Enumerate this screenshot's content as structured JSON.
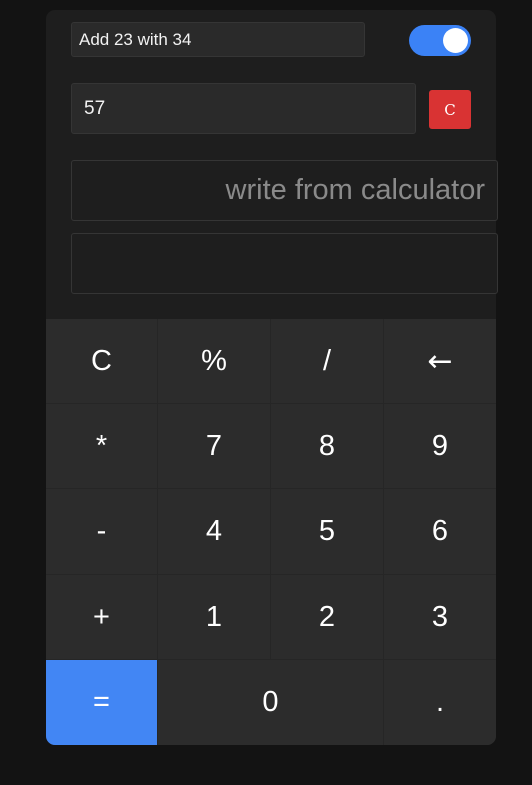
{
  "prompt": {
    "value": "Add 23 with 34"
  },
  "toggle": {
    "state": "on",
    "accent_color": "#3b82f6"
  },
  "result": {
    "value": "57"
  },
  "clear_button": {
    "label": "C",
    "color": "#d93333"
  },
  "display": {
    "placeholder": "write from calculator",
    "value": ""
  },
  "display_secondary": {
    "value": ""
  },
  "keypad": {
    "equals_color": "#4286f4",
    "keys": [
      {
        "label": "C"
      },
      {
        "label": "%"
      },
      {
        "label": "/"
      },
      {
        "label": "←"
      },
      {
        "label": "*"
      },
      {
        "label": "7"
      },
      {
        "label": "8"
      },
      {
        "label": "9"
      },
      {
        "label": "-"
      },
      {
        "label": "4"
      },
      {
        "label": "5"
      },
      {
        "label": "6"
      },
      {
        "label": "+"
      },
      {
        "label": "1"
      },
      {
        "label": "2"
      },
      {
        "label": "3"
      },
      {
        "label": "="
      },
      {
        "label": "0"
      },
      {
        "label": "."
      }
    ]
  }
}
